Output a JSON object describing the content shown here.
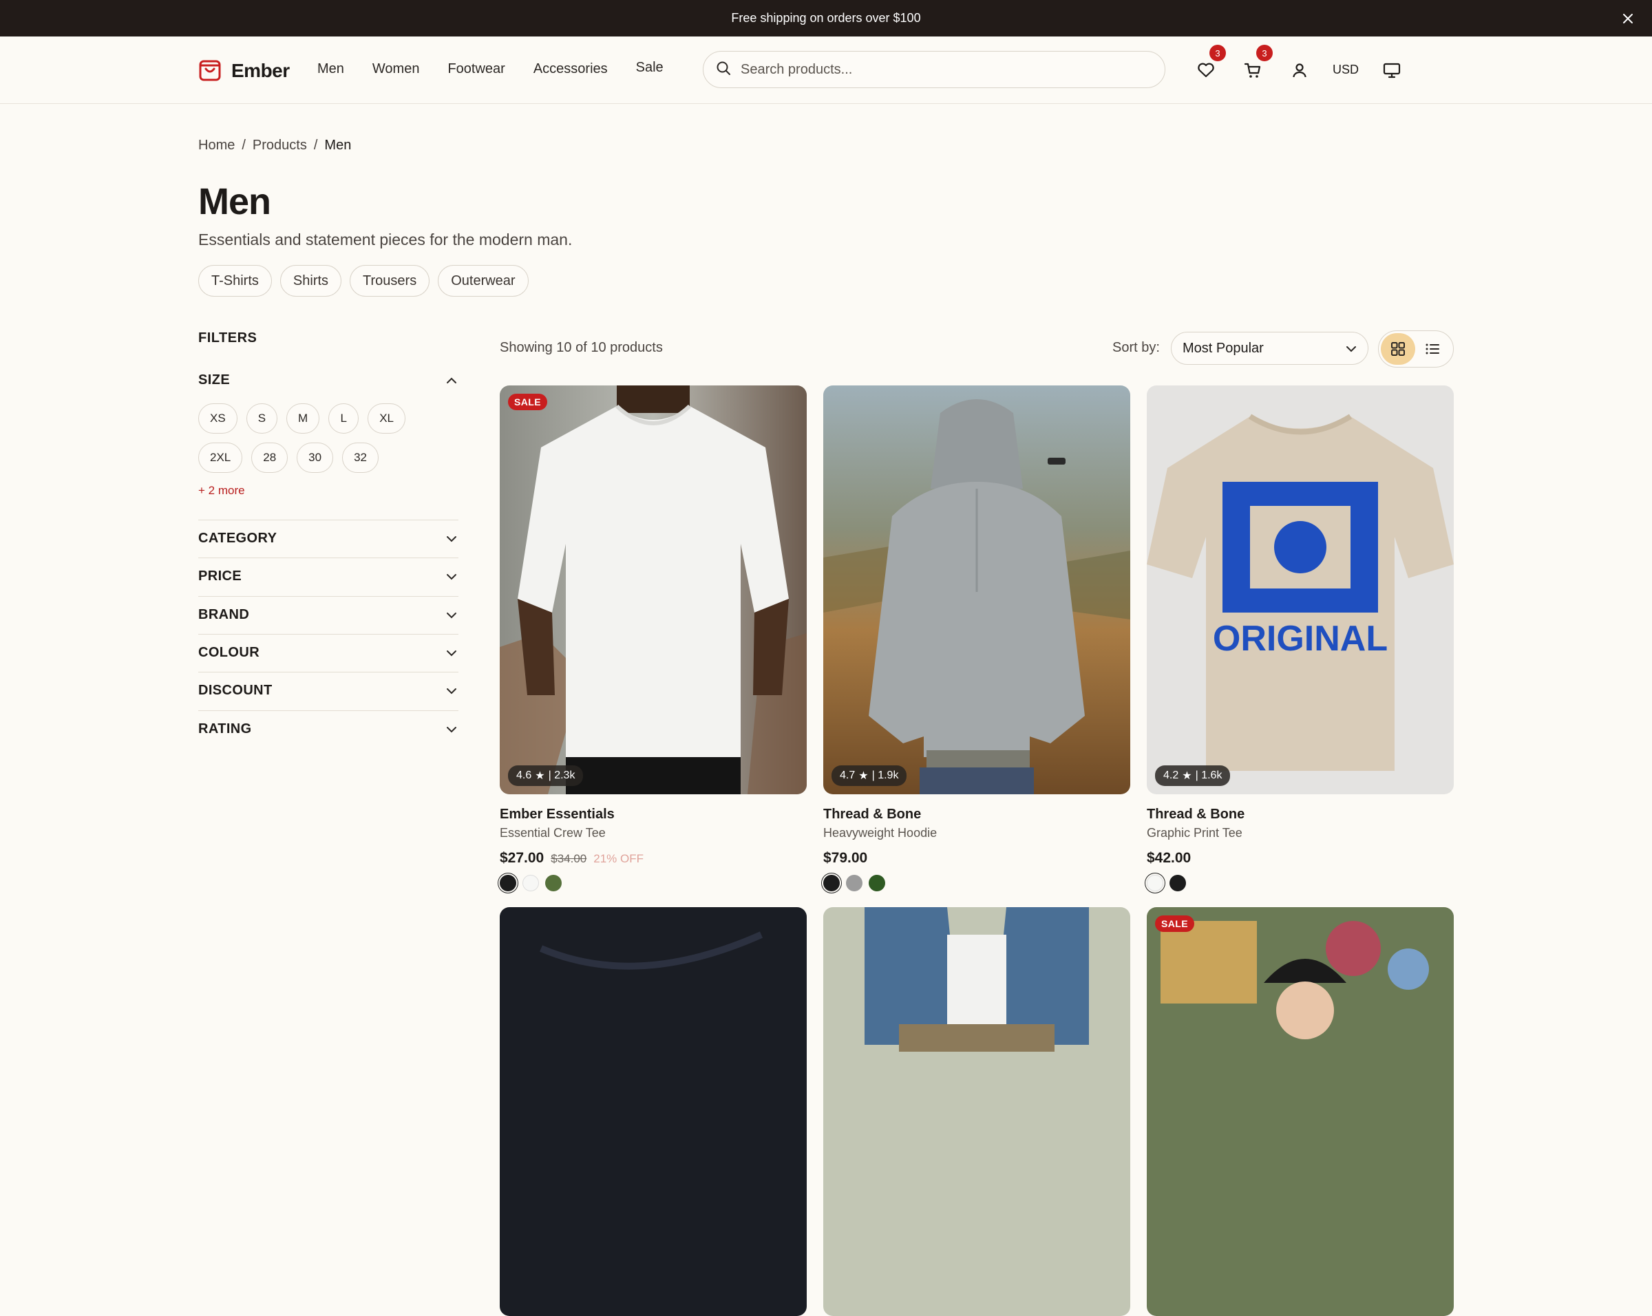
{
  "banner": {
    "text": "Free shipping on orders over $100"
  },
  "header": {
    "logo": "Ember",
    "nav": [
      "Men",
      "Women",
      "Footwear",
      "Accessories",
      "Sale"
    ],
    "search_placeholder": "Search products...",
    "wishlist_count": "3",
    "cart_count": "3",
    "currency": "USD"
  },
  "breadcrumb": {
    "home": "Home",
    "products": "Products",
    "current": "Men",
    "sep": "/"
  },
  "page": {
    "title": "Men",
    "subtitle": "Essentials and statement pieces for the modern man.",
    "chips": [
      "T-Shirts",
      "Shirts",
      "Trousers",
      "Outerwear"
    ]
  },
  "filters": {
    "title": "FILTERS",
    "size_label": "SIZE",
    "sizes": [
      "XS",
      "S",
      "M",
      "L",
      "XL",
      "2XL",
      "28",
      "30",
      "32"
    ],
    "more": "+ 2 more",
    "sections": [
      "CATEGORY",
      "PRICE",
      "BRAND",
      "COLOUR",
      "DISCOUNT",
      "RATING"
    ]
  },
  "results": {
    "showing": "Showing 10 of 10 products",
    "sort_label": "Sort by:",
    "sort_value": "Most Popular"
  },
  "products": [
    {
      "brand": "Ember Essentials",
      "name": "Essential Crew Tee",
      "price": "$27.00",
      "old_price": "$34.00",
      "discount": "21% OFF",
      "rating": "4.6",
      "reviews": "| 2.3k",
      "sale": "SALE",
      "swatches": [
        "#1c1c1c",
        "#f7f7f5",
        "#55703a"
      ]
    },
    {
      "brand": "Thread & Bone",
      "name": "Heavyweight Hoodie",
      "price": "$79.00",
      "rating": "4.7",
      "reviews": "| 1.9k",
      "swatches": [
        "#1c1c1c",
        "#9b9b9b",
        "#2f5a23"
      ]
    },
    {
      "brand": "Thread & Bone",
      "name": "Graphic Print Tee",
      "price": "$42.00",
      "rating": "4.2",
      "reviews": "| 1.6k",
      "swatches": [
        "#f7f7f5",
        "#1c1c1c"
      ]
    }
  ],
  "bottom_row": {
    "sale_badge": "SALE"
  },
  "colors": {
    "accent": "#c81e1e",
    "banner_bg": "#221b18",
    "page_bg": "#fcfaf5",
    "view_active": "#f3d39a"
  }
}
